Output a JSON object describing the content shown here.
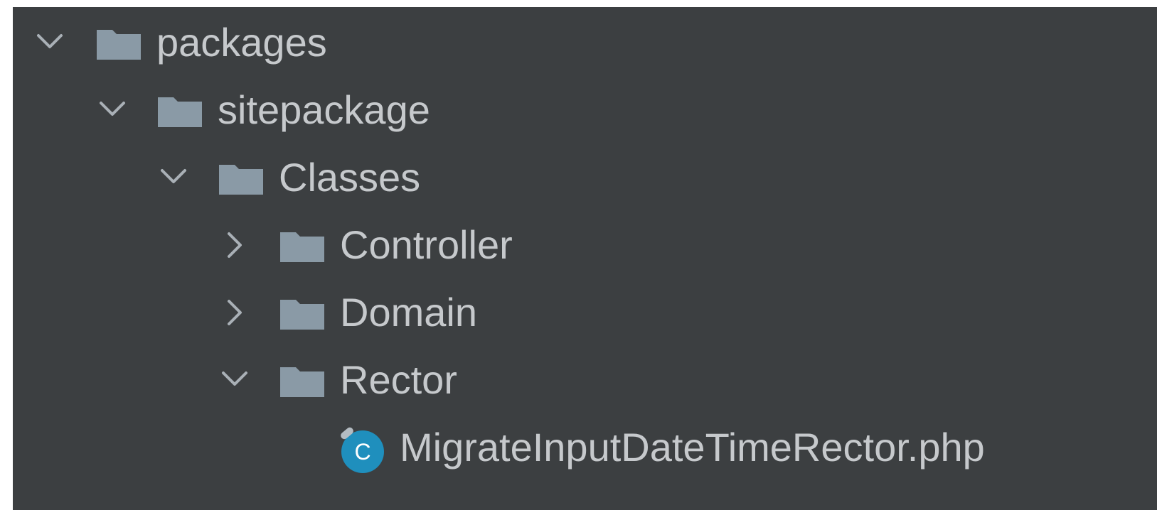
{
  "project_tree": {
    "colors": {
      "background": "#3c3f41",
      "text": "#c6c9cc",
      "folder": "#8a9aa6",
      "chevron": "#a9b0b6",
      "class_icon": "#1f8fbd"
    },
    "items": [
      {
        "label": "packages",
        "expanded": true,
        "icon": "folder-icon"
      },
      {
        "label": "sitepackage",
        "expanded": true,
        "icon": "folder-icon"
      },
      {
        "label": "Classes",
        "expanded": true,
        "icon": "folder-icon"
      },
      {
        "label": "Controller",
        "expanded": false,
        "icon": "folder-icon"
      },
      {
        "label": "Domain",
        "expanded": false,
        "icon": "folder-icon"
      },
      {
        "label": "Rector",
        "expanded": true,
        "icon": "folder-icon"
      },
      {
        "label": "MigrateInputDateTimeRector.php",
        "icon": "php-class-icon",
        "icon_letter": "C"
      }
    ]
  }
}
